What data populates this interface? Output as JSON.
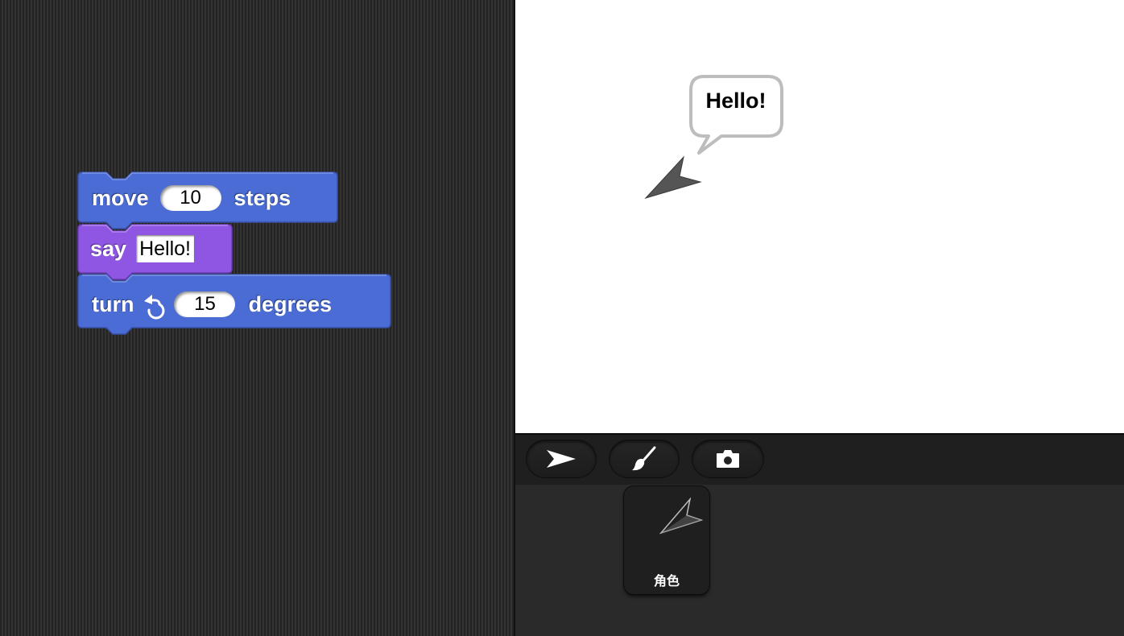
{
  "script": {
    "blocks": [
      {
        "kind": "motion",
        "label_before": "move",
        "input": "10",
        "label_after": "steps"
      },
      {
        "kind": "looks",
        "label_before": "say",
        "input": "Hello!"
      },
      {
        "kind": "motion",
        "label_before": "turn",
        "direction_icon": "rotate-left-icon",
        "input": "15",
        "label_after": "degrees"
      }
    ]
  },
  "stage": {
    "speech_bubble": "Hello!",
    "sprite_shape": "arrowhead-icon"
  },
  "corral": {
    "buttons": [
      {
        "name": "turtle-icon"
      },
      {
        "name": "paintbrush-icon"
      },
      {
        "name": "camera-icon"
      }
    ],
    "sprites": [
      {
        "name": "角色",
        "thumbnail": "arrowhead-icon"
      }
    ]
  },
  "colors": {
    "motion": "#4a6cd4",
    "looks": "#8f56e3",
    "stage_bg": "#ffffff",
    "script_bg": "#2a2a2a"
  }
}
